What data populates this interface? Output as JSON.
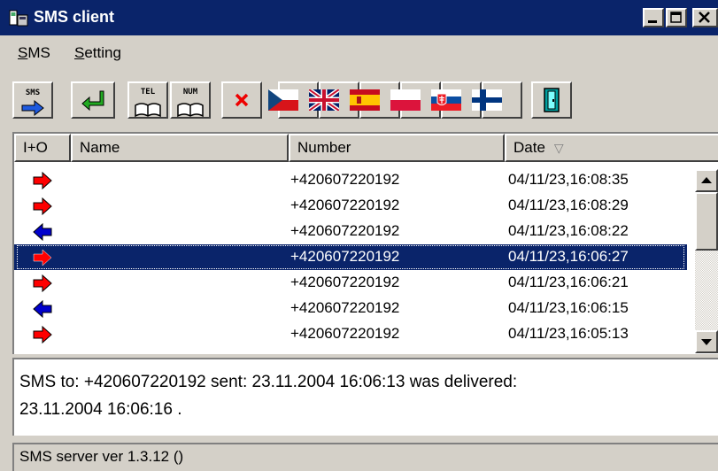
{
  "window": {
    "title": "SMS client"
  },
  "menu": {
    "sms_label": "SMS",
    "sms_mnemonic": "S",
    "sms_rest": "MS",
    "setting_label": "Setting",
    "setting_mnemonic": "S",
    "setting_rest": "etting"
  },
  "toolbar": {
    "items": [
      {
        "name": "send-sms",
        "text": "SMS",
        "icon": "sms-send-icon"
      },
      {
        "name": "reply",
        "icon": "green-return-arrow-icon"
      },
      {
        "name": "phonebook-tel",
        "text": "TEL",
        "icon": "book-icon"
      },
      {
        "name": "phonebook-num",
        "text": "NUM",
        "icon": "book-icon"
      },
      {
        "name": "delete",
        "icon": "red-x-icon"
      },
      {
        "name": "lang-czech",
        "icon": "czech-flag-icon"
      },
      {
        "name": "lang-english",
        "icon": "uk-flag-icon"
      },
      {
        "name": "lang-spanish",
        "icon": "spain-flag-icon"
      },
      {
        "name": "lang-polish",
        "icon": "poland-flag-icon"
      },
      {
        "name": "lang-slovak",
        "icon": "slovakia-flag-icon"
      },
      {
        "name": "lang-finnish",
        "icon": "finland-flag-icon"
      },
      {
        "name": "exit",
        "icon": "exit-door-icon"
      }
    ]
  },
  "list": {
    "columns": [
      "I+O",
      "Name",
      "Number",
      "Date"
    ],
    "sort_indicator": "▽",
    "rows": [
      {
        "direction": "out",
        "name": "",
        "number": "+420607220192",
        "date": "04/11/23,16:08:35",
        "selected": false
      },
      {
        "direction": "out",
        "name": "",
        "number": "+420607220192",
        "date": "04/11/23,16:08:29",
        "selected": false
      },
      {
        "direction": "in",
        "name": "",
        "number": "+420607220192",
        "date": "04/11/23,16:08:22",
        "selected": false
      },
      {
        "direction": "out",
        "name": "",
        "number": "+420607220192",
        "date": "04/11/23,16:06:27",
        "selected": true
      },
      {
        "direction": "out",
        "name": "",
        "number": "+420607220192",
        "date": "04/11/23,16:06:21",
        "selected": false
      },
      {
        "direction": "in",
        "name": "",
        "number": "+420607220192",
        "date": "04/11/23,16:06:15",
        "selected": false
      },
      {
        "direction": "out",
        "name": "",
        "number": "+420607220192",
        "date": "04/11/23,16:05:13",
        "selected": false
      }
    ]
  },
  "message": {
    "line1": "SMS to: +420607220192 sent: 23.11.2004 16:06:13 was delivered:",
    "line2": "23.11.2004 16:06:16 ."
  },
  "status": {
    "text": "SMS server ver 1.3.12 ()"
  },
  "colors": {
    "titlebar": "#0a246a",
    "out_arrow": "#ff0000",
    "in_arrow": "#0000cc",
    "selection": "#0a246a"
  }
}
